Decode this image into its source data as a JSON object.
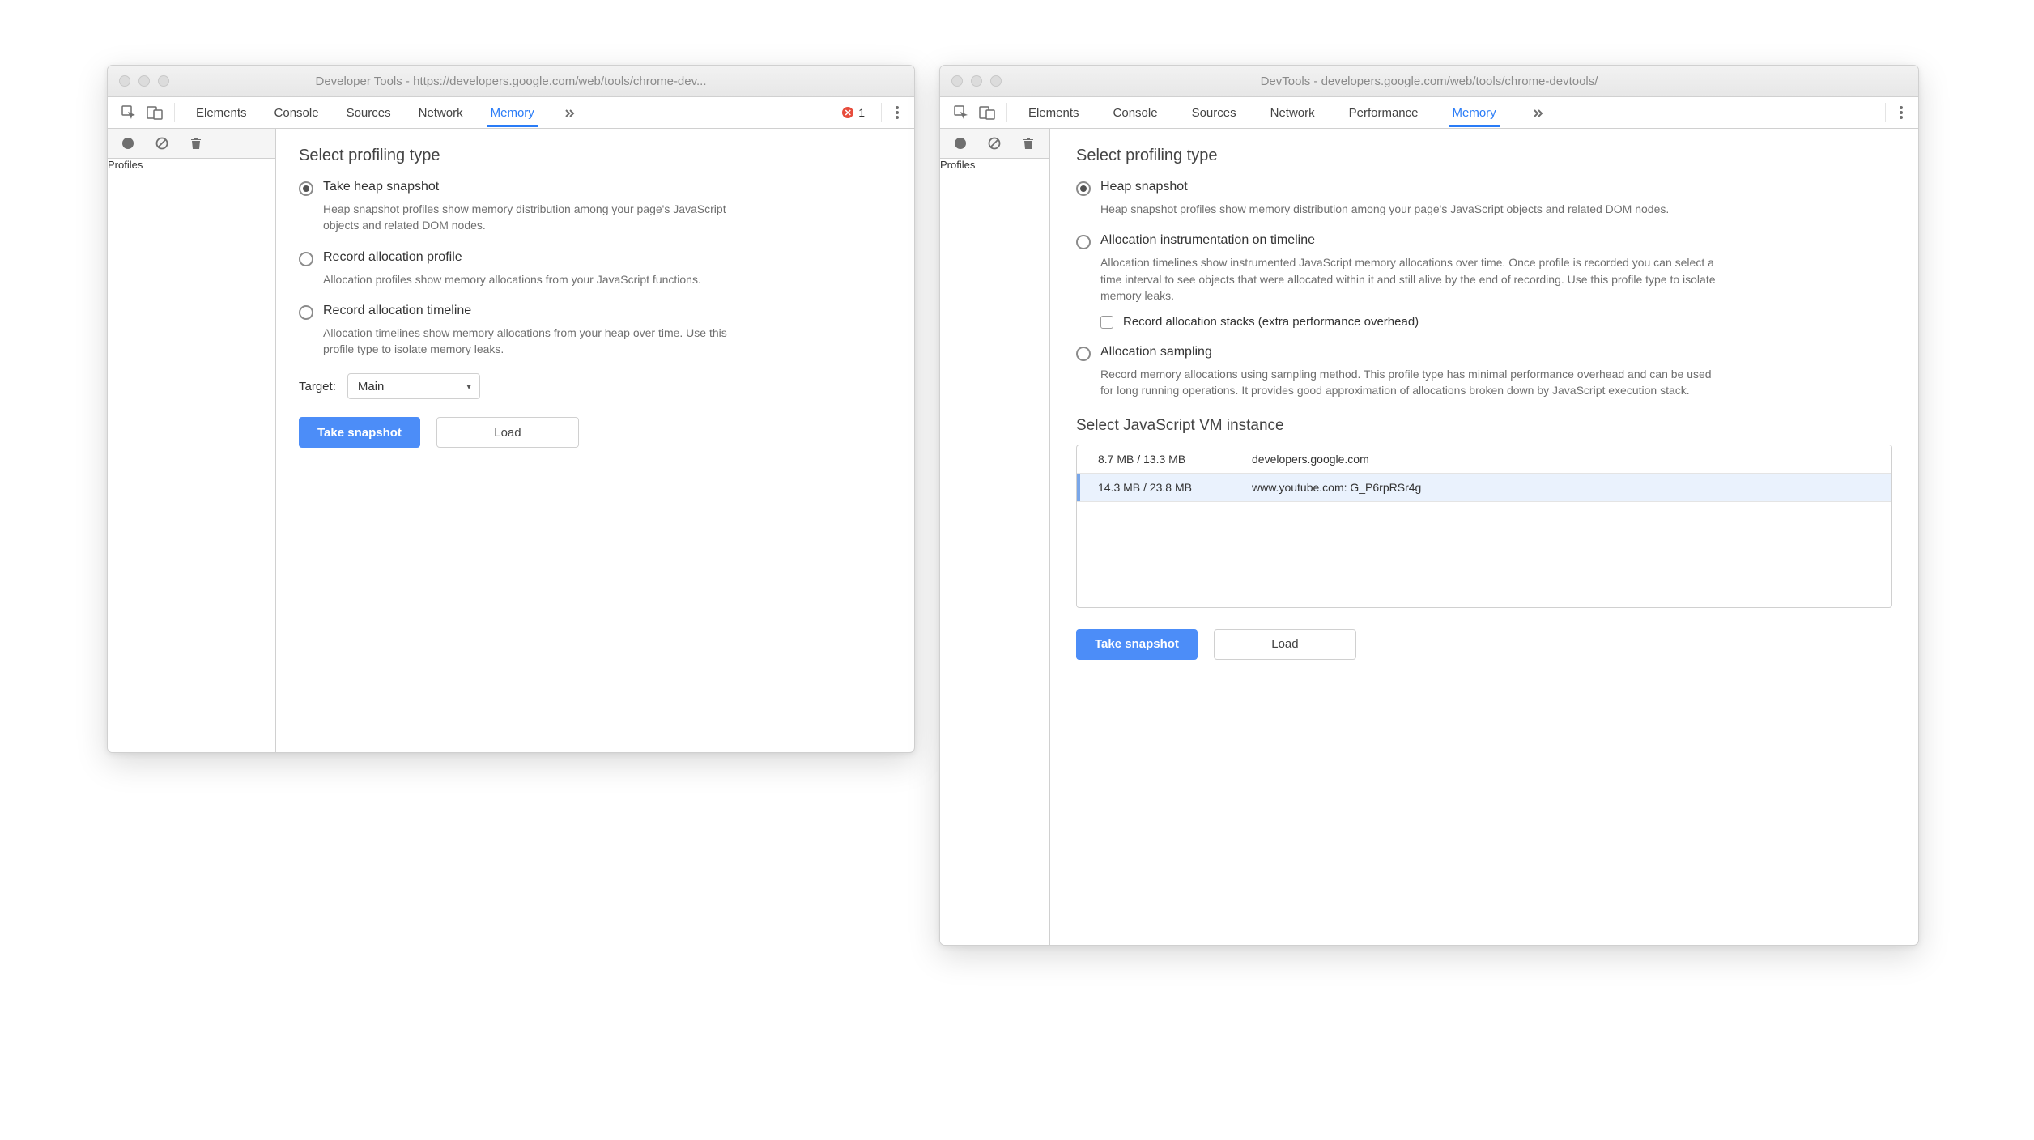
{
  "leftWindow": {
    "title": "Developer Tools - https://developers.google.com/web/tools/chrome-dev...",
    "tabs": [
      "Elements",
      "Console",
      "Sources",
      "Network",
      "Memory"
    ],
    "activeTab": "Memory",
    "errorCount": "1",
    "sidebar": {
      "profiles_label": "Profiles"
    },
    "main": {
      "heading": "Select profiling type",
      "options": [
        {
          "title": "Take heap snapshot",
          "desc": "Heap snapshot profiles show memory distribution among your page's JavaScript objects and related DOM nodes.",
          "selected": true
        },
        {
          "title": "Record allocation profile",
          "desc": "Allocation profiles show memory allocations from your JavaScript functions.",
          "selected": false
        },
        {
          "title": "Record allocation timeline",
          "desc": "Allocation timelines show memory allocations from your heap over time. Use this profile type to isolate memory leaks.",
          "selected": false
        }
      ],
      "target_label": "Target:",
      "target_value": "Main",
      "take_snapshot_label": "Take snapshot",
      "load_label": "Load"
    }
  },
  "rightWindow": {
    "title": "DevTools - developers.google.com/web/tools/chrome-devtools/",
    "tabs": [
      "Elements",
      "Console",
      "Sources",
      "Network",
      "Performance",
      "Memory"
    ],
    "activeTab": "Memory",
    "sidebar": {
      "profiles_label": "Profiles"
    },
    "main": {
      "heading": "Select profiling type",
      "options": [
        {
          "title": "Heap snapshot",
          "desc": "Heap snapshot profiles show memory distribution among your page's JavaScript objects and related DOM nodes.",
          "selected": true
        },
        {
          "title": "Allocation instrumentation on timeline",
          "desc": "Allocation timelines show instrumented JavaScript memory allocations over time. Once profile is recorded you can select a time interval to see objects that were allocated within it and still alive by the end of recording. Use this profile type to isolate memory leaks.",
          "selected": false,
          "checkbox": "Record allocation stacks (extra performance overhead)"
        },
        {
          "title": "Allocation sampling",
          "desc": "Record memory allocations using sampling method. This profile type has minimal performance overhead and can be used for long running operations. It provides good approximation of allocations broken down by JavaScript execution stack.",
          "selected": false
        }
      ],
      "vm_heading": "Select JavaScript VM instance",
      "vm_rows": [
        {
          "mem": "8.7 MB / 13.3 MB",
          "name": "developers.google.com",
          "selected": false
        },
        {
          "mem": "14.3 MB / 23.8 MB",
          "name": "www.youtube.com: G_P6rpRSr4g",
          "selected": true
        }
      ],
      "take_snapshot_label": "Take snapshot",
      "load_label": "Load"
    }
  }
}
